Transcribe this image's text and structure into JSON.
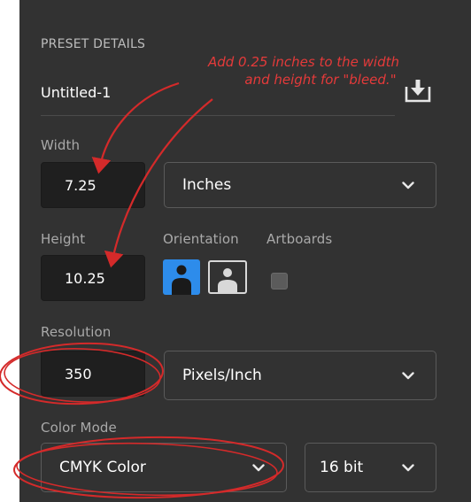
{
  "preset": {
    "section_title": "PRESET DETAILS",
    "document_name": "Untitled-1"
  },
  "width": {
    "label": "Width",
    "value": "7.25",
    "unit": "Inches"
  },
  "height": {
    "label": "Height",
    "value": "10.25"
  },
  "orientation": {
    "label": "Orientation",
    "selected": "portrait"
  },
  "artboards": {
    "label": "Artboards",
    "checked": false
  },
  "resolution": {
    "label": "Resolution",
    "value": "350",
    "unit": "Pixels/Inch"
  },
  "color_mode": {
    "label": "Color Mode",
    "mode": "CMYK Color",
    "bit_depth": "16 bit"
  },
  "annotation": {
    "line1": "Add 0.25 inches to the width",
    "line2": "and height for \"bleed.\""
  },
  "colors": {
    "panel_bg": "#323232",
    "field_bg": "#1f1f1f",
    "accent_blue": "#2d8ceb",
    "annotation_red": "#d42a2a"
  },
  "icons": [
    "save-preset-icon",
    "chevron-down-icon",
    "portrait-orientation-icon",
    "landscape-orientation-icon"
  ]
}
